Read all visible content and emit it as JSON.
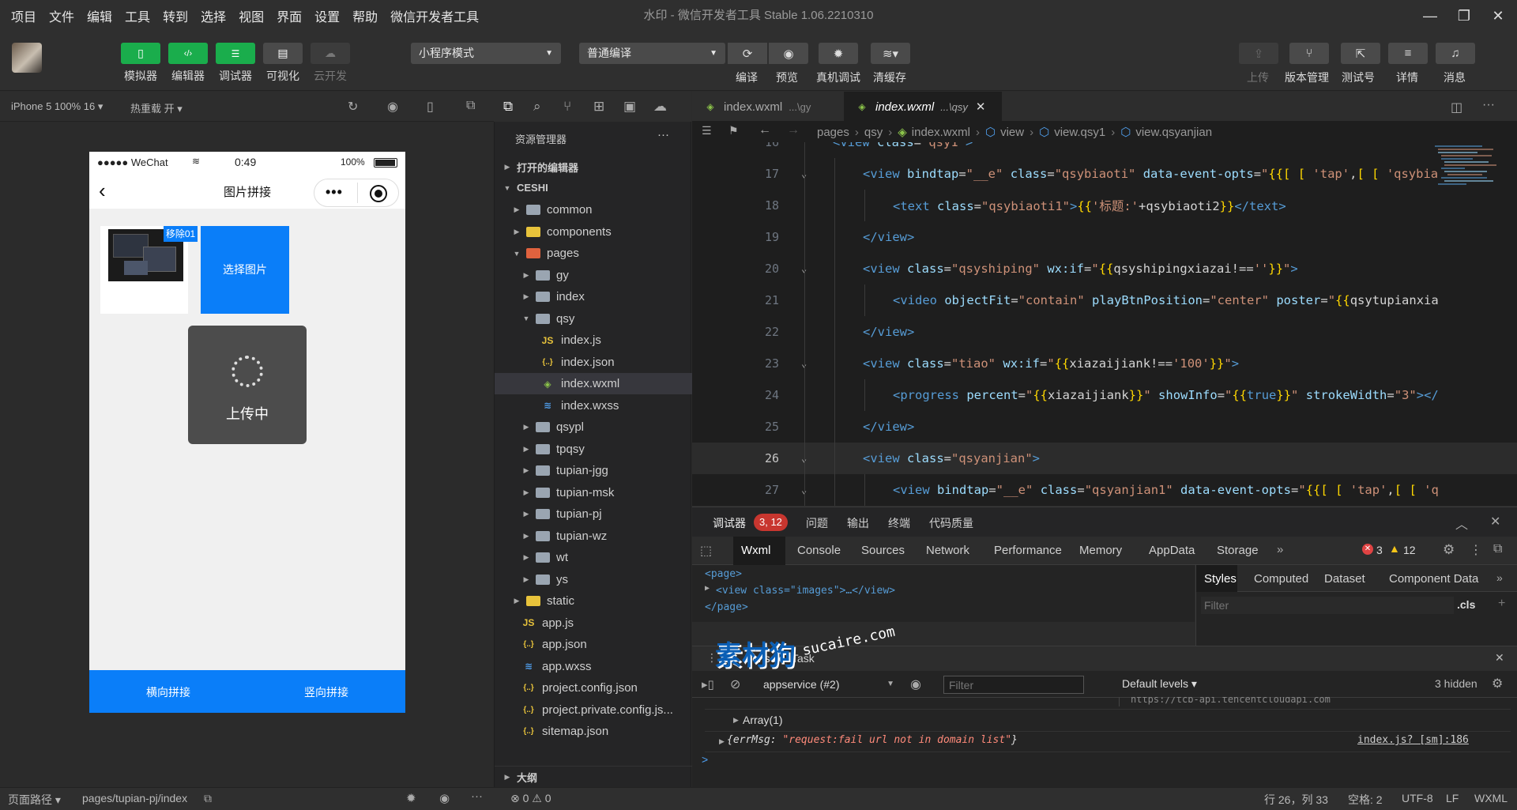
{
  "menu": [
    "项目",
    "文件",
    "编辑",
    "工具",
    "转到",
    "选择",
    "视图",
    "界面",
    "设置",
    "帮助",
    "微信开发者工具"
  ],
  "window_title": "水印 - 微信开发者工具 Stable 1.06.2210310",
  "toolbar": {
    "buttons": [
      {
        "label": "模拟器",
        "icon": "phone-icon"
      },
      {
        "label": "编辑器",
        "icon": "code-icon"
      },
      {
        "label": "调试器",
        "icon": "debug-sliders-icon"
      },
      {
        "label": "可视化",
        "icon": "layout-icon"
      },
      {
        "label": "云开发",
        "icon": "cloud-icon"
      }
    ],
    "mode_select": "小程序模式",
    "compile_select": "普通编译",
    "actions": [
      {
        "label": "编译",
        "icon": "refresh-icon"
      },
      {
        "label": "预览",
        "icon": "eye-icon"
      },
      {
        "label": "真机调试",
        "icon": "bug-icon"
      },
      {
        "label": "清缓存",
        "icon": "layers-icon"
      }
    ],
    "right": [
      {
        "label": "上传",
        "icon": "upload-icon"
      },
      {
        "label": "版本管理",
        "icon": "branch-icon"
      },
      {
        "label": "测试号",
        "icon": "external-icon"
      },
      {
        "label": "详情",
        "icon": "menu-icon"
      },
      {
        "label": "消息",
        "icon": "bell-icon"
      }
    ]
  },
  "simulator": {
    "device": "iPhone 5 100% 16",
    "hot_reload": "热重载 开",
    "status": {
      "carrier": "●●●●● WeChat",
      "time": "0:49",
      "battery": "100%"
    },
    "nav_title": "图片拼接",
    "remove_badge": "移除01",
    "choose_button": "选择图片",
    "loading_text": "上传中",
    "bottom": {
      "left": "横向拼接",
      "right": "竖向拼接"
    }
  },
  "explorer": {
    "title": "资源管理器",
    "more": "···",
    "open_editors": "打开的编辑器",
    "project": "CESHI",
    "items": [
      {
        "name": "common",
        "type": "folder",
        "depth": 1
      },
      {
        "name": "components",
        "type": "folder-yellow",
        "depth": 1
      },
      {
        "name": "pages",
        "type": "folder-red",
        "depth": 1,
        "open": true
      },
      {
        "name": "gy",
        "type": "folder",
        "depth": 2
      },
      {
        "name": "index",
        "type": "folder",
        "depth": 2
      },
      {
        "name": "qsy",
        "type": "folder",
        "depth": 2,
        "open": true
      },
      {
        "name": "index.js",
        "type": "js",
        "depth": 3
      },
      {
        "name": "index.json",
        "type": "json",
        "depth": 3
      },
      {
        "name": "index.wxml",
        "type": "wxml",
        "depth": 3,
        "active": true
      },
      {
        "name": "index.wxss",
        "type": "wxss",
        "depth": 3
      },
      {
        "name": "qsypl",
        "type": "folder",
        "depth": 2
      },
      {
        "name": "tpqsy",
        "type": "folder",
        "depth": 2
      },
      {
        "name": "tupian-jgg",
        "type": "folder",
        "depth": 2
      },
      {
        "name": "tupian-msk",
        "type": "folder",
        "depth": 2
      },
      {
        "name": "tupian-pj",
        "type": "folder",
        "depth": 2
      },
      {
        "name": "tupian-wz",
        "type": "folder",
        "depth": 2
      },
      {
        "name": "wt",
        "type": "folder",
        "depth": 2
      },
      {
        "name": "ys",
        "type": "folder",
        "depth": 2
      },
      {
        "name": "static",
        "type": "folder-yellow",
        "depth": 1
      },
      {
        "name": "app.js",
        "type": "js",
        "depth": 1
      },
      {
        "name": "app.json",
        "type": "json",
        "depth": 1
      },
      {
        "name": "app.wxss",
        "type": "wxss",
        "depth": 1
      },
      {
        "name": "project.config.json",
        "type": "json",
        "depth": 1
      },
      {
        "name": "project.private.config.js...",
        "type": "json",
        "depth": 1
      },
      {
        "name": "sitemap.json",
        "type": "json",
        "depth": 1
      }
    ],
    "outline": "大纲"
  },
  "editor": {
    "tabs": [
      {
        "name": "index.wxml",
        "hint": "...\\gy"
      },
      {
        "name": "index.wxml",
        "hint": "...\\qsy"
      }
    ],
    "breadcrumb": [
      "pages",
      "qsy",
      "index.wxml",
      "view",
      "view.qsy1",
      "view.qsyanjian"
    ],
    "lines": [
      {
        "n": "16",
        "indent": 1,
        "parts": [
          [
            "t",
            "<view "
          ],
          [
            "a",
            "class"
          ],
          [
            "w",
            "="
          ],
          [
            "s",
            "\"qsy1\""
          ],
          [
            "t",
            ">"
          ]
        ]
      },
      {
        "n": "17",
        "indent": 2,
        "fold": true,
        "parts": [
          [
            "t",
            "<view "
          ],
          [
            "a",
            "bindtap"
          ],
          [
            "w",
            "="
          ],
          [
            "s",
            "\"__e\""
          ],
          [
            "w",
            " "
          ],
          [
            "a",
            "class"
          ],
          [
            "w",
            "="
          ],
          [
            "s",
            "\"qsybiaoti\""
          ],
          [
            "w",
            " "
          ],
          [
            "a",
            "data-event-opts"
          ],
          [
            "w",
            "="
          ],
          [
            "s",
            "\""
          ],
          [
            "p",
            "{{"
          ],
          [
            "p",
            "["
          ],
          [
            "w",
            " "
          ],
          [
            "p",
            "["
          ],
          [
            "w",
            " "
          ],
          [
            "s",
            "'tap'"
          ],
          [
            "w",
            ","
          ],
          [
            "p",
            "["
          ],
          [
            "w",
            " "
          ],
          [
            "p",
            "["
          ],
          [
            "w",
            " "
          ],
          [
            "s",
            "'qsybia"
          ]
        ]
      },
      {
        "n": "18",
        "indent": 3,
        "parts": [
          [
            "t",
            "<text "
          ],
          [
            "a",
            "class"
          ],
          [
            "w",
            "="
          ],
          [
            "s",
            "\"qsybiaoti1\""
          ],
          [
            "t",
            ">"
          ],
          [
            "p",
            "{{"
          ],
          [
            "s",
            "'标题:'"
          ],
          [
            "w",
            "+qsybiaoti2"
          ],
          [
            "p",
            "}}"
          ],
          [
            "t",
            "</text>"
          ]
        ]
      },
      {
        "n": "19",
        "indent": 2,
        "parts": [
          [
            "t",
            "</view>"
          ]
        ]
      },
      {
        "n": "20",
        "indent": 2,
        "fold": true,
        "parts": [
          [
            "t",
            "<view "
          ],
          [
            "a",
            "class"
          ],
          [
            "w",
            "="
          ],
          [
            "s",
            "\"qsyshiping\""
          ],
          [
            "w",
            " "
          ],
          [
            "a",
            "wx:if"
          ],
          [
            "w",
            "="
          ],
          [
            "s",
            "\""
          ],
          [
            "p",
            "{{"
          ],
          [
            "w",
            "qsyshipingxiazai!=="
          ],
          [
            "s",
            "''"
          ],
          [
            "p",
            "}}"
          ],
          [
            "s",
            "\""
          ],
          [
            "t",
            ">"
          ]
        ]
      },
      {
        "n": "21",
        "indent": 3,
        "parts": [
          [
            "t",
            "<video "
          ],
          [
            "a",
            "objectFit"
          ],
          [
            "w",
            "="
          ],
          [
            "s",
            "\"contain\""
          ],
          [
            "w",
            " "
          ],
          [
            "a",
            "playBtnPosition"
          ],
          [
            "w",
            "="
          ],
          [
            "s",
            "\"center\""
          ],
          [
            "w",
            " "
          ],
          [
            "a",
            "poster"
          ],
          [
            "w",
            "="
          ],
          [
            "s",
            "\""
          ],
          [
            "p",
            "{{"
          ],
          [
            "w",
            "qsytupianxia"
          ]
        ]
      },
      {
        "n": "22",
        "indent": 2,
        "parts": [
          [
            "t",
            "</view>"
          ]
        ]
      },
      {
        "n": "23",
        "indent": 2,
        "fold": true,
        "parts": [
          [
            "t",
            "<view "
          ],
          [
            "a",
            "class"
          ],
          [
            "w",
            "="
          ],
          [
            "s",
            "\"tiao\""
          ],
          [
            "w",
            " "
          ],
          [
            "a",
            "wx:if"
          ],
          [
            "w",
            "="
          ],
          [
            "s",
            "\""
          ],
          [
            "p",
            "{{"
          ],
          [
            "w",
            "xiazaijiank!=="
          ],
          [
            "s",
            "'100'"
          ],
          [
            "p",
            "}}"
          ],
          [
            "s",
            "\""
          ],
          [
            "t",
            ">"
          ]
        ]
      },
      {
        "n": "24",
        "indent": 3,
        "parts": [
          [
            "t",
            "<progress "
          ],
          [
            "a",
            "percent"
          ],
          [
            "w",
            "="
          ],
          [
            "s",
            "\""
          ],
          [
            "p",
            "{{"
          ],
          [
            "w",
            "xiazaijiank"
          ],
          [
            "p",
            "}}"
          ],
          [
            "s",
            "\""
          ],
          [
            "w",
            " "
          ],
          [
            "a",
            "showInfo"
          ],
          [
            "w",
            "="
          ],
          [
            "s",
            "\""
          ],
          [
            "p",
            "{{"
          ],
          [
            "t",
            "true"
          ],
          [
            "p",
            "}}"
          ],
          [
            "s",
            "\""
          ],
          [
            "w",
            " "
          ],
          [
            "a",
            "strokeWidth"
          ],
          [
            "w",
            "="
          ],
          [
            "s",
            "\"3\""
          ],
          [
            "t",
            "></"
          ]
        ]
      },
      {
        "n": "25",
        "indent": 2,
        "parts": [
          [
            "t",
            "</view>"
          ]
        ]
      },
      {
        "n": "26",
        "indent": 2,
        "fold": true,
        "current": true,
        "parts": [
          [
            "t",
            "<view "
          ],
          [
            "a",
            "class"
          ],
          [
            "w",
            "="
          ],
          [
            "s",
            "\"qsyanjian\""
          ],
          [
            "t",
            ">"
          ]
        ]
      },
      {
        "n": "27",
        "indent": 3,
        "fold": true,
        "parts": [
          [
            "t",
            "<view "
          ],
          [
            "a",
            "bindtap"
          ],
          [
            "w",
            "="
          ],
          [
            "s",
            "\"__e\""
          ],
          [
            "w",
            " "
          ],
          [
            "a",
            "class"
          ],
          [
            "w",
            "="
          ],
          [
            "s",
            "\"qsyanjian1\""
          ],
          [
            "w",
            " "
          ],
          [
            "a",
            "data-event-opts"
          ],
          [
            "w",
            "="
          ],
          [
            "s",
            "\""
          ],
          [
            "p",
            "{{"
          ],
          [
            "p",
            "["
          ],
          [
            "w",
            " "
          ],
          [
            "p",
            "["
          ],
          [
            "w",
            " "
          ],
          [
            "s",
            "'tap'"
          ],
          [
            "w",
            ","
          ],
          [
            "p",
            "["
          ],
          [
            "w",
            " "
          ],
          [
            "p",
            "["
          ],
          [
            "w",
            " "
          ],
          [
            "s",
            "'q"
          ]
        ]
      }
    ]
  },
  "devtools": {
    "title": "调试器",
    "badge": "3, 12",
    "tabs_top": [
      "问题",
      "输出",
      "终端",
      "代码质量"
    ],
    "tabs": [
      "Wxml",
      "Console",
      "Sources",
      "Network",
      "Performance",
      "Memory",
      "AppData",
      "Storage"
    ],
    "errors": "3",
    "warnings": "12",
    "wxml": [
      "<page>",
      "<view class=\"images\">…</view>",
      "</page>"
    ],
    "styles_tabs": [
      "Styles",
      "Computed",
      "Dataset",
      "Component Data"
    ],
    "filter_placeholder": "Filter",
    "cls": ".cls",
    "drawer_tabs": [
      "Console",
      "Task"
    ],
    "context": "appservice (#2)",
    "console_filter": "Filter",
    "levels": "Default levels",
    "hidden": "3 hidden",
    "console_lines": {
      "partial_url": "https://tcb-api.tencentcloudapi.com",
      "array": "Array(1)",
      "err_key": "{errMsg: ",
      "err_val": "\"request:fail url not in domain list\"",
      "err_end": "}",
      "err_src": "index.js? [sm]:186"
    },
    "prompt": ">"
  },
  "watermark": {
    "cn": "素材狗",
    "en": "sucaire.com"
  },
  "footer": {
    "path_label": "页面路径",
    "path": "pages/tupian-pj/index",
    "errors": "0",
    "warnings": "0",
    "cursor": "行 26，列 33",
    "spaces": "空格: 2",
    "encoding": "UTF-8",
    "eol": "LF",
    "lang": "WXML"
  },
  "colors": {
    "accent_green": "#1aad4c",
    "wechat_blue": "#0a7ef9",
    "error_red": "#e04343"
  }
}
